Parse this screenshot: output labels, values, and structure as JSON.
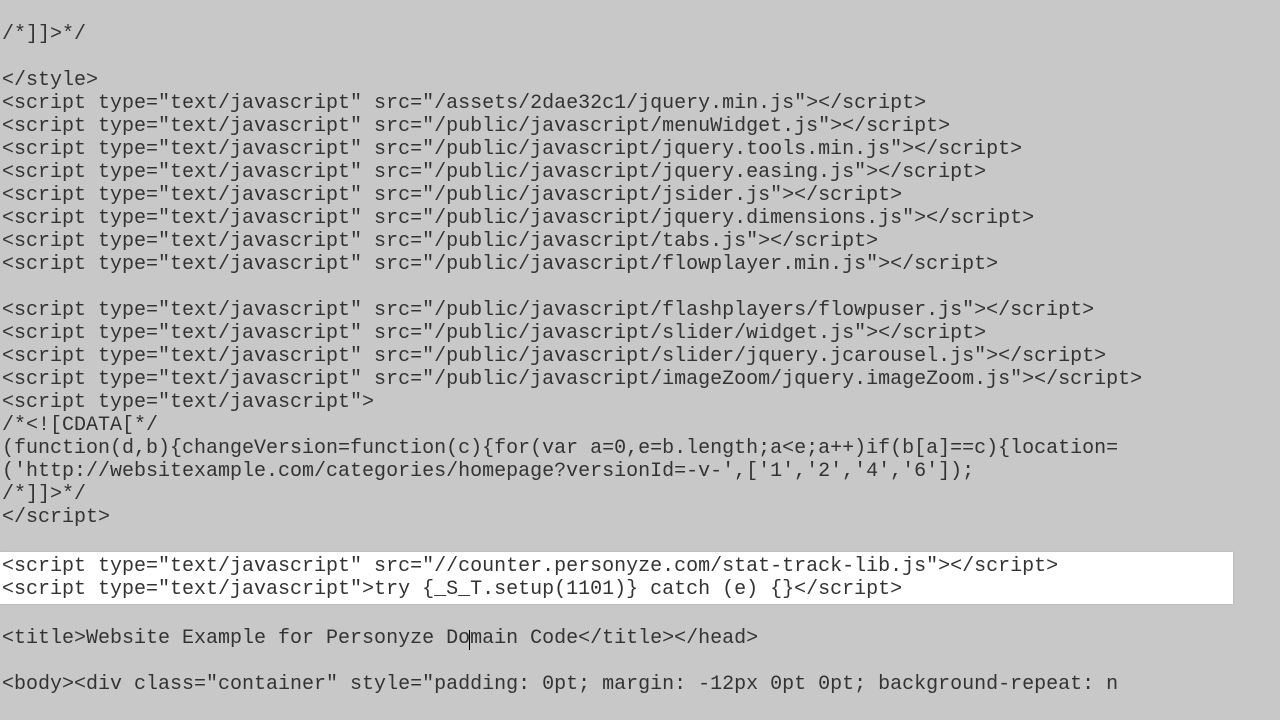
{
  "source": {
    "blank_top": "",
    "l01": "/*]]>*/",
    "l02": "</style>",
    "l03": "<script type=\"text/javascript\" src=\"/assets/2dae32c1/jquery.min.js\"></script>",
    "l04": "<script type=\"text/javascript\" src=\"/public/javascript/menuWidget.js\"></script>",
    "l05": "<script type=\"text/javascript\" src=\"/public/javascript/jquery.tools.min.js\"></script>",
    "l06": "<script type=\"text/javascript\" src=\"/public/javascript/jquery.easing.js\"></script>",
    "l07": "<script type=\"text/javascript\" src=\"/public/javascript/jsider.js\"></script>",
    "l08": "<script type=\"text/javascript\" src=\"/public/javascript/jquery.dimensions.js\"></script>",
    "l09": "<script type=\"text/javascript\" src=\"/public/javascript/tabs.js\"></script>",
    "l10": "<script type=\"text/javascript\" src=\"/public/javascript/flowplayer.min.js\"></script>",
    "l11": "<script type=\"text/javascript\" src=\"/public/javascript/flashplayers/flowpuser.js\"></script>",
    "l12": "<script type=\"text/javascript\" src=\"/public/javascript/slider/widget.js\"></script>",
    "l13": "<script type=\"text/javascript\" src=\"/public/javascript/slider/jquery.jcarousel.js\"></script>",
    "l14": "<script type=\"text/javascript\" src=\"/public/javascript/imageZoom/jquery.imageZoom.js\"></script>",
    "l15": "<script type=\"text/javascript\">",
    "l16": "/*<![CDATA[*/",
    "l17": "(function(d,b){changeVersion=function(c){for(var a=0,e=b.length;a<e;a++)if(b[a]==c){location=",
    "l18": "('http://websitexample.com/categories/homepage?versionId=-v-',['1','2','4','6']);",
    "l19": "/*]]>*/",
    "l20": "</script>",
    "hl1": "<script type=\"text/javascript\" src=\"//counter.personyze.com/stat-track-lib.js\"></script>",
    "hl2": "<script type=\"text/javascript\">try {_S_T.setup(1101)} catch (e) {}</script>",
    "title_pre": "<title>Website Example for Personyze Do",
    "title_post": "main Code</title></head>",
    "body": "<body><div class=\"container\" style=\"padding: 0pt; margin: -12px 0pt 0pt; background-repeat: n"
  }
}
